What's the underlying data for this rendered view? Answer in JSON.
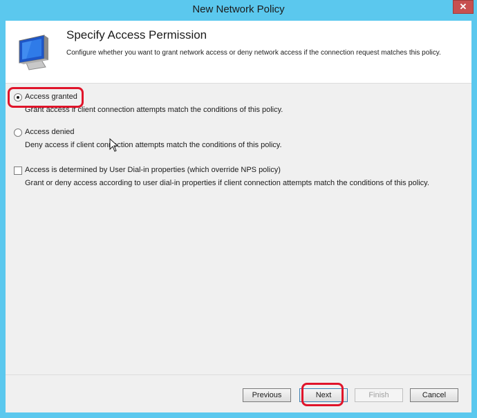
{
  "window": {
    "title": "New Network Policy",
    "close_label": "✕"
  },
  "header": {
    "title": "Specify Access Permission",
    "description": "Configure whether you want to grant network access or deny network access if the connection request matches this policy.",
    "icon": "monitor-icon"
  },
  "options": [
    {
      "type": "radio",
      "label": "Access granted",
      "description": "Grant access if client connection attempts match the conditions of this policy.",
      "checked": true
    },
    {
      "type": "radio",
      "label": "Access denied",
      "description": "Deny access if client connection attempts match the conditions of this policy.",
      "checked": false
    },
    {
      "type": "checkbox",
      "label": "Access is determined by User Dial-in properties (which override NPS policy)",
      "description": "Grant or deny access according to user dial-in properties if client connection attempts match the conditions of this policy.",
      "checked": false
    }
  ],
  "buttons": {
    "previous": "Previous",
    "next": "Next",
    "finish": "Finish",
    "cancel": "Cancel"
  },
  "colors": {
    "frame": "#5bc8ee",
    "highlight": "#e0142a"
  }
}
